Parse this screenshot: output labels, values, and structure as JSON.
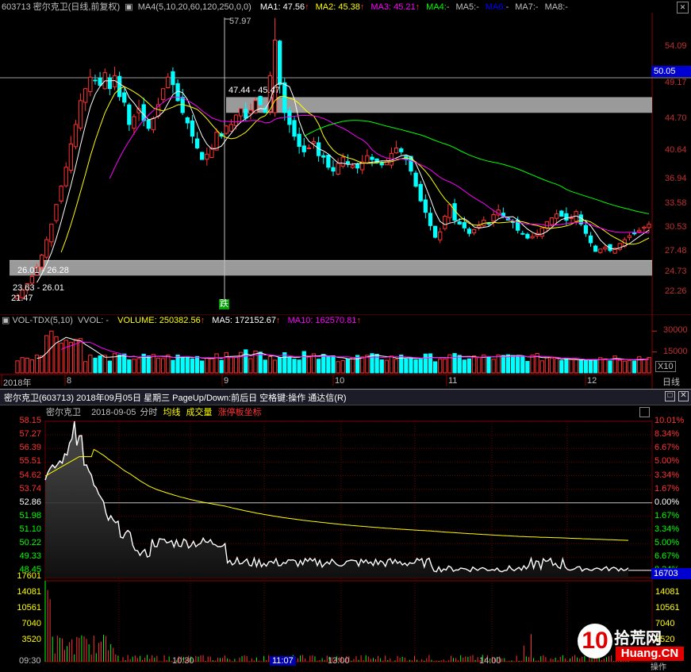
{
  "kline": {
    "code_title": "603713 密尔克卫(日线,前复权)",
    "ma_header": "MA4(5,10,20,60,120,250,0,0)",
    "ma_items": [
      {
        "text": "MA1: 47.56",
        "color": "#ffffff",
        "arrow": "↑"
      },
      {
        "text": "MA2: 45.38",
        "color": "#ffff00",
        "arrow": "↑"
      },
      {
        "text": "MA3: 45.21",
        "color": "#ff00ff",
        "arrow": "↑"
      },
      {
        "text": "MA4:",
        "color": "#00ff00",
        "arrow": "-"
      },
      {
        "text": "MA5:",
        "color": "#c0c0c0",
        "arrow": "-"
      },
      {
        "text": "MA6:",
        "color": "#0000ff",
        "arrow": "-"
      },
      {
        "text": "MA7:",
        "color": "#c0c0c0",
        "arrow": "-"
      },
      {
        "text": "MA8:",
        "color": "#c0c0c0",
        "arrow": "-"
      }
    ],
    "price_axis": [
      "54.09",
      "49.17",
      "44.70",
      "40.64",
      "36.94",
      "33.58",
      "30.53",
      "27.48",
      "24.73",
      "22.26"
    ],
    "current_price_tag": "50.05",
    "high_label": "57.97",
    "zone_upper_label": "47.44 - 45.47",
    "zone_lower_label_a": "26.01 - 26.28",
    "zone_lower_label_b": "23.63 - 26.01",
    "low_label": "21.47",
    "marker_label": "跌"
  },
  "volume": {
    "header_name": "VOL-TDX(5,10)",
    "vvol": "VVOL: -",
    "volume": "VOLUME: 250382.56",
    "ma5": "MA5: 172152.67",
    "ma10": "MA10: 162570.81",
    "axis": [
      "30000",
      "15000"
    ],
    "unit": "X10",
    "months": [
      "2018年",
      "8",
      "9",
      "10",
      "11",
      "12"
    ],
    "period": "日线"
  },
  "intraday": {
    "window_title": "密尔克卫(603713) 2018年09月05日 星期三 PageUp/Down:前后日 空格键:操作 通达信(R)",
    "name": "密尔克卫",
    "date": "2018-09-05",
    "mode": "分时",
    "avg_line": "均线",
    "vol_label": "成交量",
    "limit_coord": "涨停板坐标",
    "price_left": [
      "58.15",
      "57.27",
      "56.39",
      "55.51",
      "54.62",
      "53.74",
      "52.86",
      "51.98",
      "51.10",
      "50.22",
      "49.33",
      "48.45"
    ],
    "pct_right": [
      "10.01%",
      "8.34%",
      "6.67%",
      "5.00%",
      "3.34%",
      "1.67%",
      "0.00%",
      "1.67%",
      "3.34%",
      "5.00%",
      "6.67%",
      "8.34%"
    ],
    "vol_left": [
      "17601",
      "14081",
      "10561",
      "7040",
      "3520"
    ],
    "vol_right": [
      "16703",
      "14081",
      "10561",
      "7040",
      "3520"
    ],
    "times": [
      "09:30",
      "10:30",
      "11:07",
      "13:00",
      "14:00"
    ],
    "watermark_big": "10",
    "watermark_cn": "拾荒网",
    "watermark_url": "Huang.CN",
    "op_label": "操作"
  },
  "colors": {
    "up": "#ff3232",
    "down": "#00ffff",
    "grid": "#8b0000",
    "zone": "#9a9a9a",
    "ma5": "#ffffff",
    "ma10": "#ffff00",
    "ma20": "#ff00ff",
    "ma60": "#00ff00"
  }
}
